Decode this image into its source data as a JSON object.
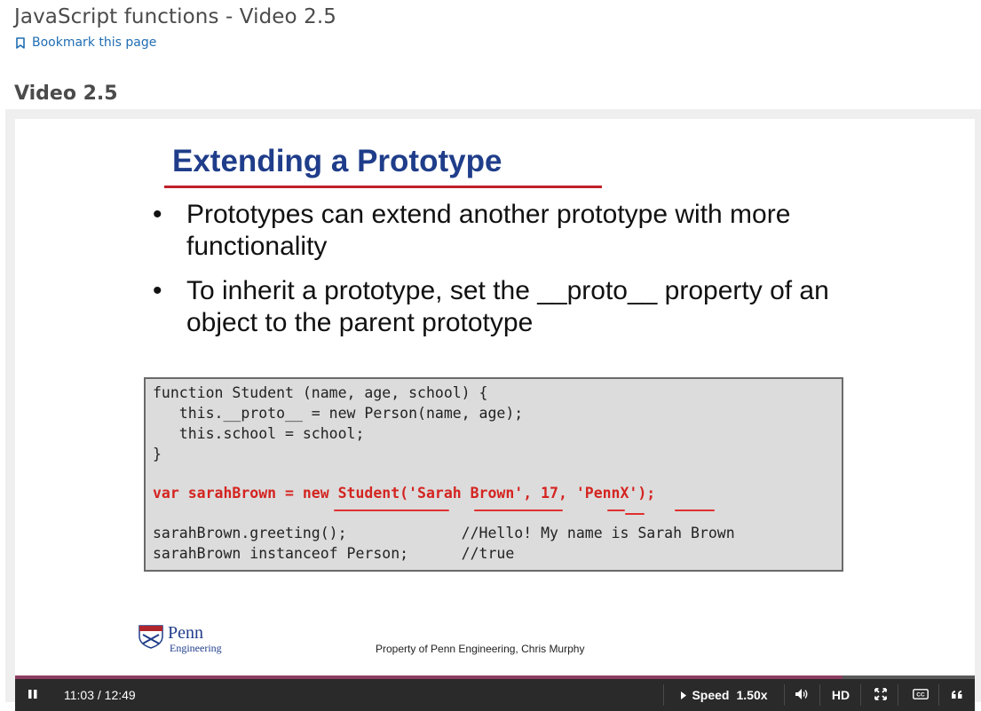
{
  "page": {
    "title": "JavaScript functions - Video 2.5",
    "bookmark_label": "Bookmark this page",
    "video_heading": "Video 2.5"
  },
  "slide": {
    "title": "Extending a Prototype",
    "bullets": [
      "Prototypes can extend another prototype with more functionality",
      "To inherit a prototype, set the __proto__ property of an object to the parent prototype"
    ],
    "code": {
      "line1": "function Student (name, age, school) {",
      "line2": "   this.__proto__ = new Person(name, age);",
      "line3": "   this.school = school;",
      "line4": "}",
      "line5": "var sarahBrown = new Student('Sarah Brown', 17, 'PennX');",
      "line6": "sarahBrown.greeting();             //Hello! My name is Sarah Brown",
      "line7": "sarahBrown instanceof Person;      //true"
    },
    "logo_text_main": "Penn",
    "logo_text_sub": "Engineering",
    "copyright": "Property of Penn Engineering, Chris Murphy"
  },
  "player": {
    "current_time": "11:03",
    "duration": "12:49",
    "time_display": "11:03 / 12:49",
    "progress_fraction": 0.862,
    "speed_label": "Speed",
    "speed_value": "1.50x",
    "hd_label": "HD",
    "accent_color": "#8c3d61",
    "icons": [
      "pause-icon",
      "play-triangle-icon",
      "volume-icon",
      "fullscreen-icon",
      "closed-captions-icon",
      "transcript-quote-icon"
    ]
  }
}
